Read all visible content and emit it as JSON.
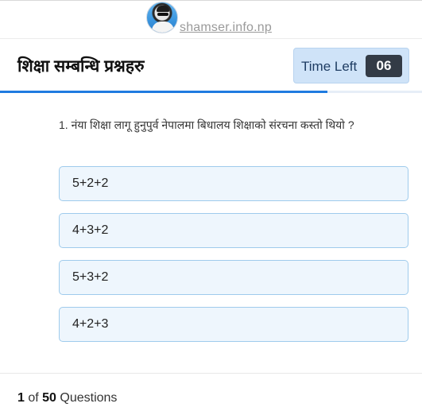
{
  "brand": {
    "site_name": "shamser.info.np"
  },
  "header": {
    "title": "शिक्षा सम्बन्धि प्रश्नहरु",
    "timer_label": "Time Left",
    "timer_value": "06"
  },
  "progress": {
    "fraction": 0.775
  },
  "question": {
    "text": "1. नंया शिक्षा लागू हुनुपुर्व नेपालमा बिधालय शिक्षाको संरचना कस्तो थियो ?"
  },
  "options": [
    {
      "label": "5+2+2"
    },
    {
      "label": "4+3+2"
    },
    {
      "label": "5+3+2"
    },
    {
      "label": "4+2+3"
    }
  ],
  "footer": {
    "current": "1",
    "of_text": " of ",
    "total": "50",
    "suffix": " Questions"
  },
  "colors": {
    "accent": "#1f7be0",
    "timer_bg": "#cfe3f8",
    "timer_value_bg": "#333b46",
    "option_bg": "#eef6fd",
    "option_border": "#9fcbec"
  }
}
